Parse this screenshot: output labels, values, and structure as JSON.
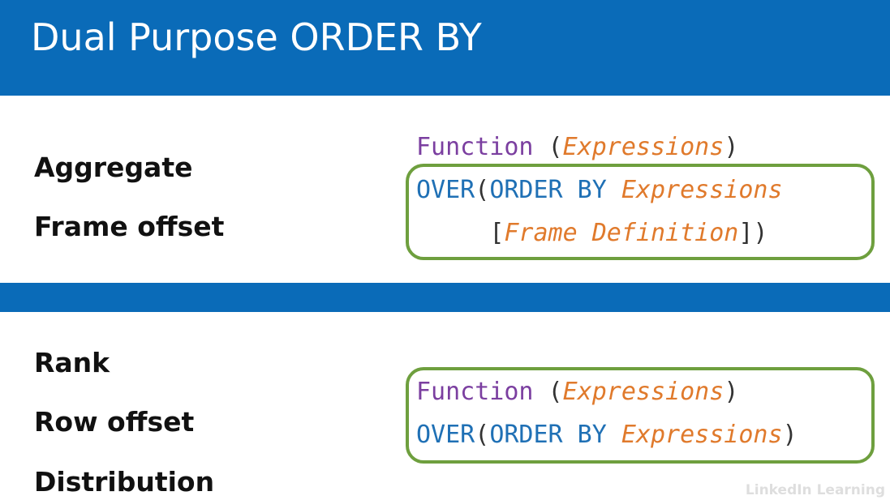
{
  "slide": {
    "title": "Dual Purpose ORDER BY"
  },
  "top_section": {
    "labels": [
      "Aggregate",
      "Frame  offset"
    ],
    "code": {
      "line1": {
        "func": "Function",
        "open": " (",
        "expr": "Expressions",
        "close": ")"
      },
      "line2": {
        "over": "OVER",
        "open": "(",
        "orderby": "ORDER BY",
        "sp": " ",
        "expr": "Expressions"
      },
      "line3": {
        "indent": "     ",
        "open": "[",
        "frame": "Frame Definition",
        "close": "])"
      }
    }
  },
  "bottom_section": {
    "labels": [
      "Rank",
      "Row  offset",
      "Distribution"
    ],
    "code": {
      "line1": {
        "func": "Function",
        "open": " (",
        "expr": "Expressions",
        "close": ")"
      },
      "line2": {
        "over": "OVER",
        "open": "(",
        "orderby": "ORDER BY",
        "sp": " ",
        "expr": "Expressions",
        "close": ")"
      }
    }
  },
  "colors": {
    "banner": "#0a6bb8",
    "function_keyword": "#7b3fa0",
    "sql_keyword": "#1f70b5",
    "expression": "#e07a2c",
    "highlight_box": "#6e9f3e"
  },
  "watermark": "LinkedIn Learning"
}
